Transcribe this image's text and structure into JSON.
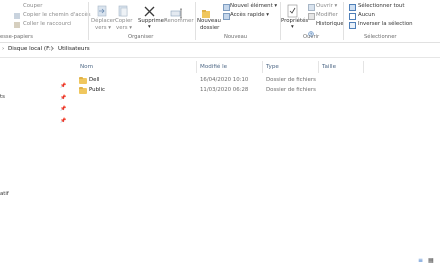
{
  "ribbon": {
    "clipboard": {
      "couper": "Couper",
      "copier_chemin": "Copier le chemin d'accès",
      "coller_raccourci": "Coller le raccourci",
      "group_label": "esse-papiers"
    },
    "organiser": {
      "deplacer": "Déplacer",
      "deplacer_vers": "vers ▾",
      "copier": "Copier",
      "copier_vers": "vers ▾",
      "supprimer": "Supprimer",
      "supprimer_arrow": "▾",
      "renommer": "Renommer",
      "group_label": "Organiser"
    },
    "nouveau": {
      "nouvel_element": "Nouvel élément ▾",
      "acces_rapide": "Accès rapide ▾",
      "nouveau": "Nouveau",
      "dossier": "dossier",
      "group_label": "Nouveau"
    },
    "ouvrir": {
      "proprietes": "Propriétés",
      "proprietes_arrow": "▾",
      "ouvrir": "Ouvrir ▾",
      "modifier": "Modifier",
      "historique": "Historique",
      "group_label": "Ouvrir"
    },
    "selectionner": {
      "tout": "Sélectionner tout",
      "aucun": "Aucun",
      "inverser": "Inverser la sélection",
      "group_label": "Sélectionner"
    }
  },
  "address": {
    "sep1": "›",
    "crumb1": "Disque local (F:)",
    "sep2": "›",
    "crumb2": "Utilisateurs"
  },
  "nav": {
    "item1": "ts",
    "item2": "atif"
  },
  "columns": {
    "nom": "Nom",
    "modifie": "Modifié le",
    "type": "Type",
    "taille": "Taille"
  },
  "rows": [
    {
      "name": "Dell",
      "modified": "16/04/2020 10:10",
      "type": "Dossier de fichiers"
    },
    {
      "name": "Public",
      "modified": "11/03/2020 06:28",
      "type": "Dossier de fichiers"
    }
  ],
  "icons": {
    "pin": "📌",
    "view_details": "≡",
    "view_tiles": "▦"
  },
  "colors": {
    "accent": "#2b6cc4",
    "folder": "#f0c75e"
  }
}
